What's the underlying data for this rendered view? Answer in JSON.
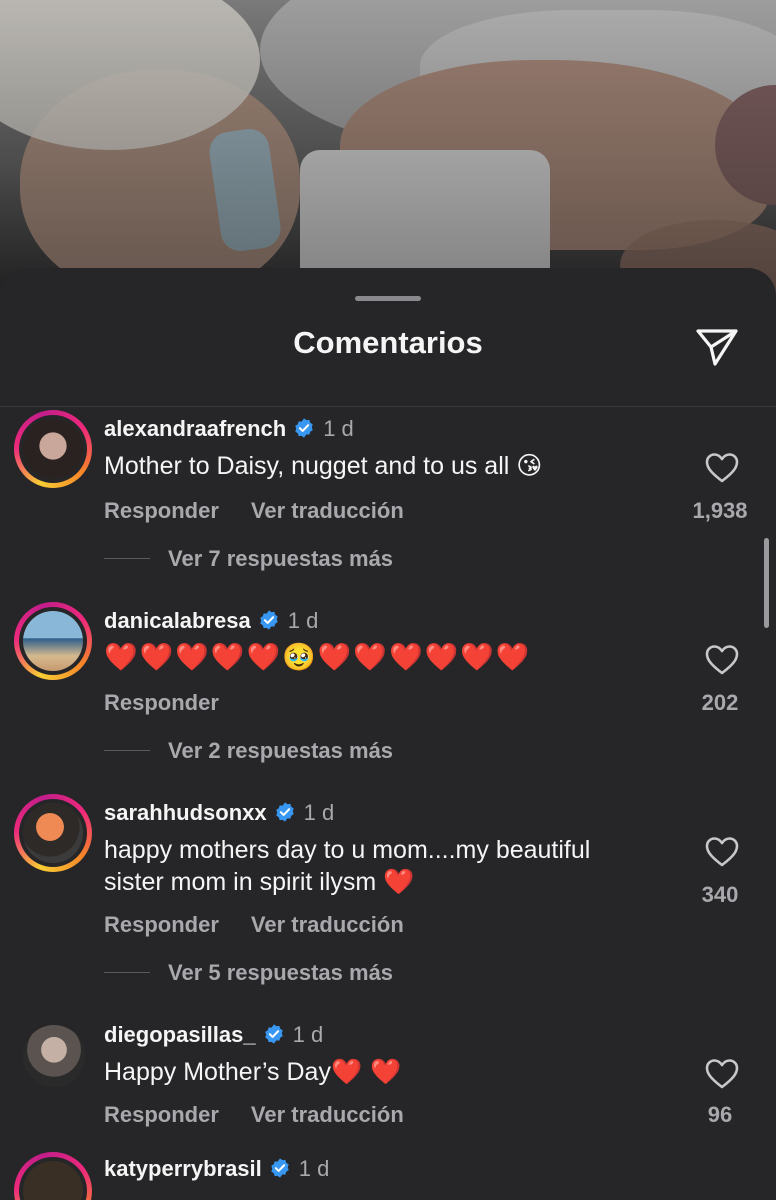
{
  "sheet": {
    "title": "Comentarios"
  },
  "comments": [
    {
      "username": "alexandraafrench",
      "time": "1 d",
      "text": "Mother to Daisy, nugget and to us all",
      "emoji": "😘",
      "reply_label": "Responder",
      "translate_label": "Ver traducción",
      "likes": "1,938",
      "replies_label": "Ver 7 respuestas más"
    },
    {
      "username": "danicalabresa",
      "time": "1 d",
      "text": "❤️❤️❤️❤️❤️🥹❤️❤️❤️❤️❤️❤️",
      "reply_label": "Responder",
      "likes": "202",
      "replies_label": "Ver 2 respuestas más"
    },
    {
      "username": "sarahhudsonxx",
      "time": "1 d",
      "text_line1": "happy mothers day to u mom....my beautiful",
      "text_line2": "sister mom in spirit ilysm",
      "emoji": "❤️",
      "reply_label": "Responder",
      "translate_label": "Ver traducción",
      "likes": "340",
      "replies_label": "Ver 5 respuestas más"
    },
    {
      "username": "diegopasillas_",
      "time": "1 d",
      "text": "Happy Mother’s Day",
      "emoji": "❤️ ❤️",
      "reply_label": "Responder",
      "translate_label": "Ver traducción",
      "likes": "96"
    },
    {
      "username": "katyperrybrasil",
      "time": "1 d"
    }
  ],
  "colors": {
    "sheet_bg": "#262628",
    "muted": "#a8a8ad",
    "verified": "#3897f0",
    "heart": "#ff2d3a"
  },
  "icons": {
    "share": "paper-plane-icon",
    "like": "heart-outline-icon",
    "verified": "verified-badge-icon"
  }
}
